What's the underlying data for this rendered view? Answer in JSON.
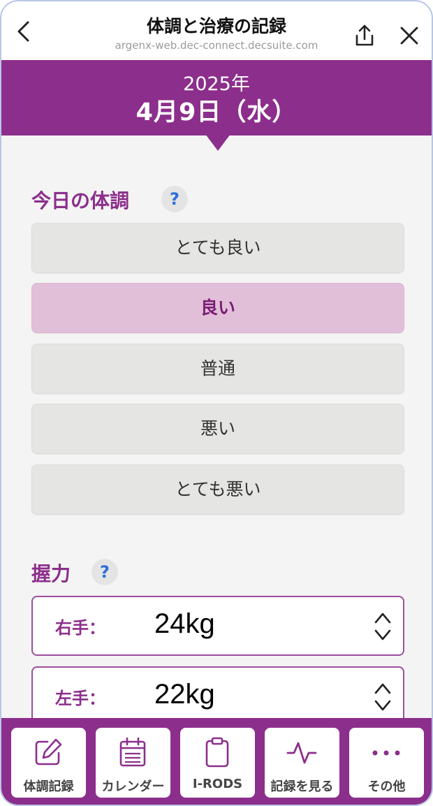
{
  "browser": {
    "title": "体調と治療の記録",
    "url": "argenx-web.dec-connect.decsuite.com",
    "icons": {
      "back": "chevron-left-icon",
      "share": "share-icon",
      "close": "close-icon"
    }
  },
  "date": {
    "year": "2025年",
    "day": "4月9日（水）"
  },
  "condition": {
    "title": "今日の体調",
    "help": "?",
    "options": [
      {
        "label": "とても良い",
        "selected": false
      },
      {
        "label": "良い",
        "selected": true
      },
      {
        "label": "普通",
        "selected": false
      },
      {
        "label": "悪い",
        "selected": false
      },
      {
        "label": "とても悪い",
        "selected": false
      }
    ]
  },
  "grip": {
    "title": "握力",
    "help": "?",
    "right": {
      "label": "右手：",
      "value": "24kg"
    },
    "left": {
      "label": "左手：",
      "value": "22kg"
    }
  },
  "nav": {
    "items": [
      {
        "label": "体調記録",
        "icon": "edit-icon"
      },
      {
        "label": "カレンダー",
        "icon": "calendar-icon"
      },
      {
        "label": "I-RODS",
        "icon": "clipboard-icon"
      },
      {
        "label": "記録を見る",
        "icon": "activity-icon"
      },
      {
        "label": "その他",
        "icon": "more-icon"
      }
    ]
  },
  "colors": {
    "brand": "#8c2e8c",
    "selected_bg": "#e2bfd9",
    "help_text": "#2f6fd9"
  }
}
